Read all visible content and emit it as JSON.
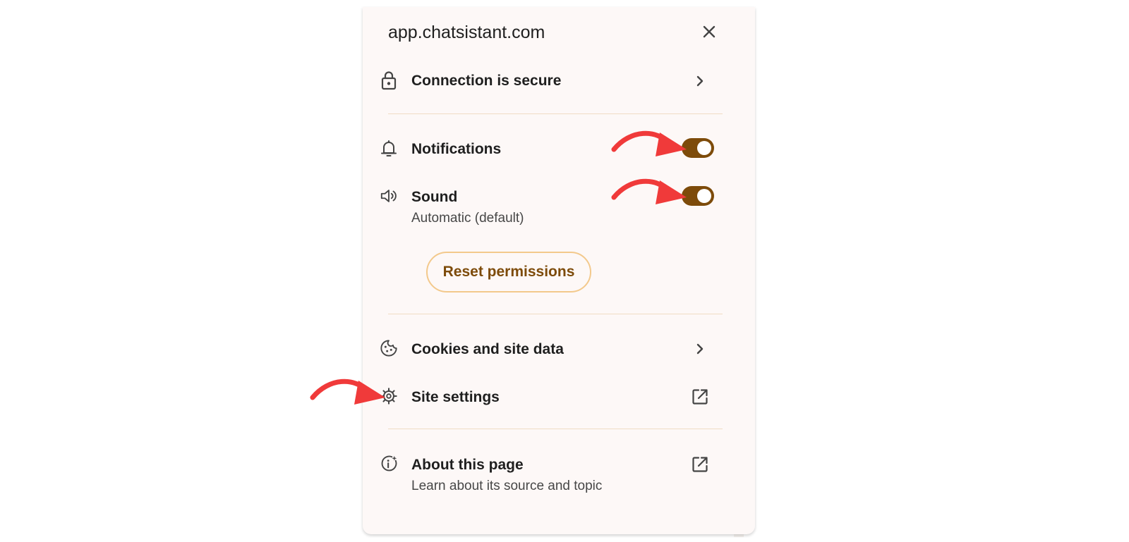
{
  "popup": {
    "site": "app.chatsistant.com",
    "connection_label": "Connection is secure",
    "notifications_label": "Notifications",
    "notifications_enabled": true,
    "sound_label": "Sound",
    "sound_sublabel": "Automatic (default)",
    "sound_enabled": true,
    "reset_label": "Reset permissions",
    "cookies_label": "Cookies and site data",
    "site_settings_label": "Site settings",
    "about_label": "About this page",
    "about_sublabel": "Learn about its source and topic"
  },
  "icons": {
    "close": "close-icon",
    "lock": "lock-icon",
    "bell": "bell-icon",
    "sound": "speaker-icon",
    "cookie": "cookie-icon",
    "gear": "gear-icon",
    "info": "info-icon",
    "chevron": "chevron-right-icon",
    "external": "open-external-icon"
  },
  "colors": {
    "toggle_on": "#7d4b0a",
    "accent_text": "#7d4b0a",
    "button_border": "#f3c98c",
    "annotation_arrow": "#f03a3a"
  }
}
